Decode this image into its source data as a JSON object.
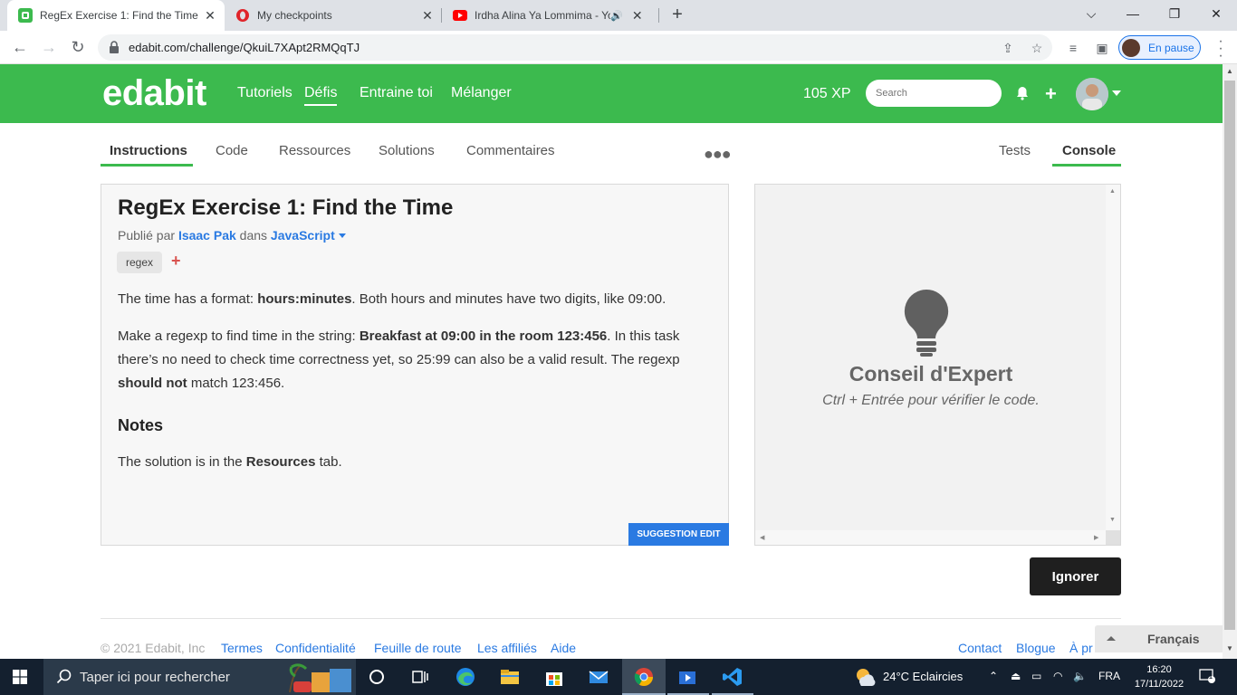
{
  "browser": {
    "tabs": [
      {
        "title": "RegEx Exercise 1: Find the Time /",
        "active": true
      },
      {
        "title": "My checkpoints",
        "active": false
      },
      {
        "title": "Irdha Alina Ya Lommima - Yo",
        "active": false
      }
    ],
    "url": "edabit.com/challenge/QkuiL7XApt2RMQqTJ",
    "profile_status": "En pause"
  },
  "site": {
    "logo": "edabit",
    "nav": [
      "Tutoriels",
      "Défis",
      "Entraine toi",
      "Mélanger"
    ],
    "nav_active": "Défis",
    "xp": "105 XP",
    "search_placeholder": "Search"
  },
  "subtabs": {
    "left": [
      "Instructions",
      "Code",
      "Ressources",
      "Solutions",
      "Commentaires"
    ],
    "right": [
      "Tests",
      "Console"
    ],
    "active_left": "Instructions",
    "active_right": "Console"
  },
  "challenge": {
    "title": "RegEx Exercise 1: Find the Time",
    "published_by": "Publié par",
    "author": "Isaac Pak",
    "in": "dans",
    "language": "JavaScript",
    "tag": "regex",
    "p1": {
      "a": "The time has a format: ",
      "b": "hours:minutes",
      "c": ". Both hours and minutes have two digits, like 09:00."
    },
    "p2": {
      "a": "Make a regexp to find time in the string: ",
      "b": "Breakfast at 09:00 in the room 123:456",
      "c": ". In this task there’s no need to check time correctness yet, so 25:99 can also be a valid result. The regexp ",
      "d": "should not",
      "e": " match 123:456."
    },
    "notes_heading": "Notes",
    "p3": {
      "a": "The solution is in the ",
      "b": "Resources",
      "c": " tab."
    },
    "suggest_edit": "SUGGESTION EDIT"
  },
  "console": {
    "title": "Conseil d'Expert",
    "subtitle": "Ctrl + Entrée pour vérifier le code."
  },
  "ignore_button": "Ignorer",
  "footer": {
    "copyright": "© 2021 Edabit, Inc",
    "links": [
      "Termes",
      "Confidentialité",
      "Feuille de route",
      "Les affiliés",
      "Aide"
    ],
    "right_links": [
      "Contact",
      "Blogue",
      "À pr"
    ],
    "language": "Français"
  },
  "taskbar": {
    "search_placeholder": "Taper ici pour rechercher",
    "weather": "24°C  Eclaircies",
    "lang": "FRA",
    "time": "16:20",
    "date": "17/11/2022",
    "notifications": "1"
  },
  "colors": {
    "brand_green": "#3cba4e",
    "link_blue": "#2a7ae2",
    "taskbar": "#14202f"
  }
}
